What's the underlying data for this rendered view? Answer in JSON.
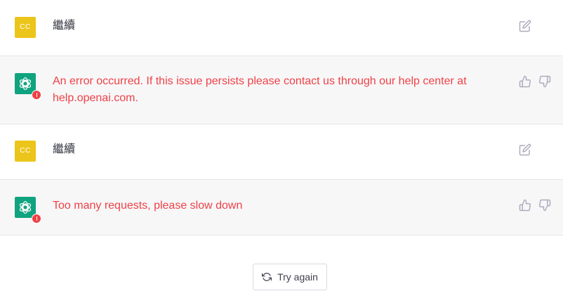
{
  "messages": [
    {
      "role": "user",
      "avatar_initials": "CC",
      "text": "繼續"
    },
    {
      "role": "assistant",
      "status": "error",
      "text": "An error occurred. If this issue persists please contact us through our help center at help.openai.com."
    },
    {
      "role": "user",
      "avatar_initials": "CC",
      "text": "繼續"
    },
    {
      "role": "assistant",
      "status": "error",
      "text": "Too many requests, please slow down"
    }
  ],
  "actions": {
    "edit_icon": "edit-icon",
    "thumbs_up_icon": "thumbs-up-icon",
    "thumbs_down_icon": "thumbs-down-icon"
  },
  "try_again": {
    "label": "Try again",
    "icon": "refresh-icon"
  },
  "colors": {
    "user_avatar_bg": "#ecc51b",
    "bot_avatar_bg": "#10a37f",
    "error_text": "#ef4146",
    "assistant_row_bg": "#f7f7f8"
  }
}
